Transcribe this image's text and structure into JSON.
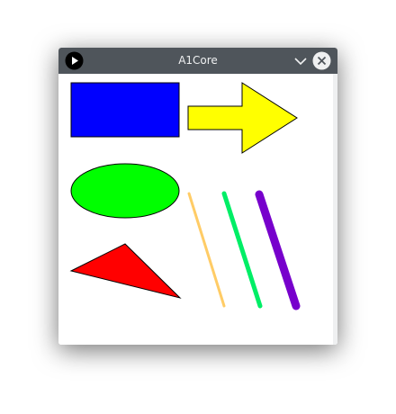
{
  "window": {
    "title": "A1Core"
  },
  "colors": {
    "titlebar": "#4f555b",
    "rectangle": "#0000ff",
    "arrow": "#ffff00",
    "ellipse": "#00ff00",
    "triangle": "#ff0000",
    "line_orange": "#ffcc66",
    "line_green": "#00ee66",
    "line_purple": "#7700cc"
  },
  "icons": {
    "app": "play-icon",
    "minimize": "chevron-down-icon",
    "close": "close-icon"
  }
}
